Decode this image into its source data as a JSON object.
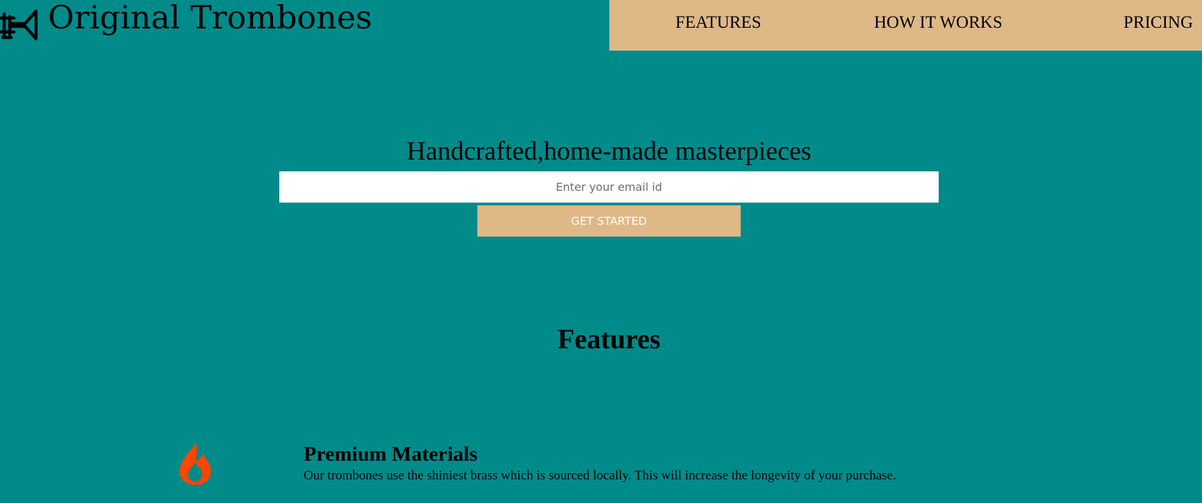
{
  "header": {
    "logo_text": "Original Trombones",
    "logo_icon": "trumpet-icon",
    "nav": {
      "background": "#deb887",
      "items": [
        {
          "label": "FEATURES"
        },
        {
          "label": "HOW IT WORKS"
        },
        {
          "label": "PRICING"
        }
      ]
    }
  },
  "hero": {
    "title": "Handcrafted,home-made masterpieces",
    "email_placeholder": "Enter your email id",
    "cta_label": "GET STARTED"
  },
  "features": {
    "heading": "Features",
    "items": [
      {
        "icon": "fire-icon",
        "icon_color": "#ff4500",
        "title": "Premium Materials",
        "description": "Our trombones use the shiniest brass which is sourced locally. This will increase the longevity of your purchase."
      }
    ]
  },
  "colors": {
    "background": "#008b8b",
    "accent": "#deb887",
    "input_background": "#ffffff"
  }
}
